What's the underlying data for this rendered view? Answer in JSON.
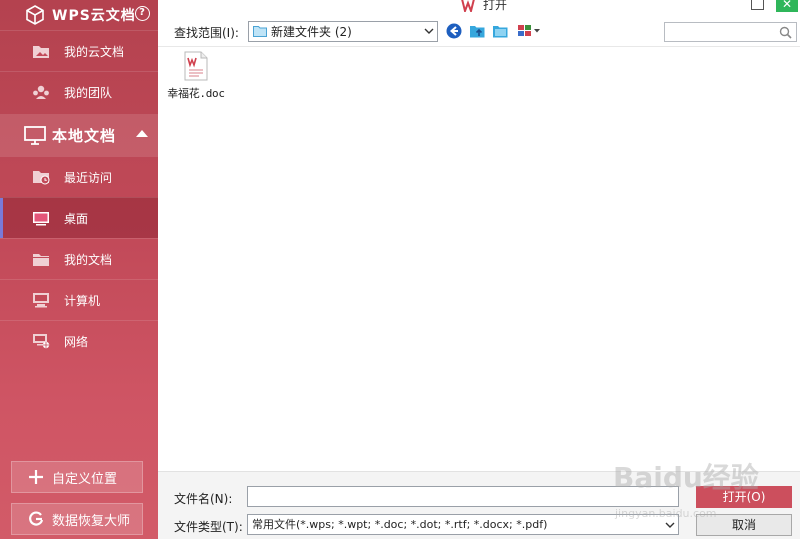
{
  "window": {
    "title": "打开"
  },
  "sidebar": {
    "header": "WPS云文档",
    "help_label": "?",
    "cloud_items": [
      {
        "label": "我的云文档",
        "icon": "cloud-docs-icon"
      },
      {
        "label": "我的团队",
        "icon": "team-icon"
      }
    ],
    "local_section": "本地文档",
    "local_items": [
      {
        "label": "最近访问",
        "icon": "recent-icon"
      },
      {
        "label": "桌面",
        "icon": "desktop-icon",
        "active": true
      },
      {
        "label": "我的文档",
        "icon": "folder-icon"
      },
      {
        "label": "计算机",
        "icon": "computer-icon"
      },
      {
        "label": "网络",
        "icon": "network-icon"
      }
    ],
    "custom_location": "自定义位置",
    "data_recovery": "数据恢复大师"
  },
  "toolbar": {
    "look_in_label": "查找范围(I):",
    "look_in_value": "新建文件夹 (2)"
  },
  "files": [
    {
      "name": "幸福花.doc",
      "icon": "word-doc-icon"
    }
  ],
  "bottom": {
    "filename_label": "文件名(N):",
    "filename_value": "",
    "filetype_label": "文件类型(T):",
    "filetype_value": "常用文件(*.wps; *.wpt; *.doc; *.dot; *.rtf; *.docx; *.pdf)",
    "open_button": "打开(O)",
    "cancel_button": "取消"
  },
  "watermark": {
    "text": "Baidu经验",
    "url": "jingyan.baidu.com"
  },
  "colors": {
    "sidebar": "#c24a59",
    "open_button": "#cc4f5d",
    "close_button": "#2fb65a",
    "back_icon": "#1e5fbf"
  }
}
